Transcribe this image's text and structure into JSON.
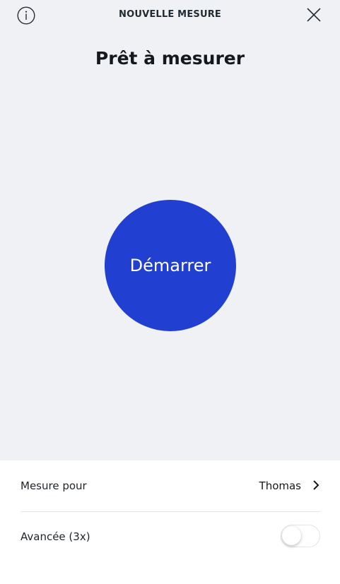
{
  "header": {
    "title": "NOUVELLE MESURE",
    "info_icon": "info-icon",
    "close_icon": "close-icon"
  },
  "main": {
    "title": "Prêt à mesurer",
    "start_button_label": "Démarrer",
    "accent_color": "#2140d1",
    "background_color": "#eff1f4"
  },
  "settings": {
    "measure_for": {
      "label": "Mesure pour",
      "value": "Thomas",
      "icon": "chevron-right-icon"
    },
    "advanced": {
      "label": "Avancée (3x)",
      "enabled": false
    }
  }
}
